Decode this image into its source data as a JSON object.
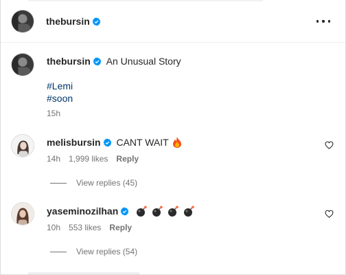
{
  "header": {
    "username": "thebursin"
  },
  "caption": {
    "username": "thebursin",
    "text": "An Unusual Story",
    "hashtags": [
      "#Lemi",
      "#soon"
    ],
    "time": "15h"
  },
  "comments": [
    {
      "username": "melisbursin",
      "text": "CANT WAIT",
      "emoji": "fire-emoji",
      "time": "14h",
      "likes": "1,999 likes",
      "reply_label": "Reply",
      "view_replies": "View replies (45)"
    },
    {
      "username": "yaseminozilhan",
      "text": "",
      "emoji": "bomb-emoji x4",
      "time": "10h",
      "likes": "553 likes",
      "reply_label": "Reply",
      "view_replies": "View replies (54)"
    }
  ],
  "colors": {
    "verified": "#0095f6",
    "hashtag": "#00376b",
    "secondary_text": "#737373"
  }
}
